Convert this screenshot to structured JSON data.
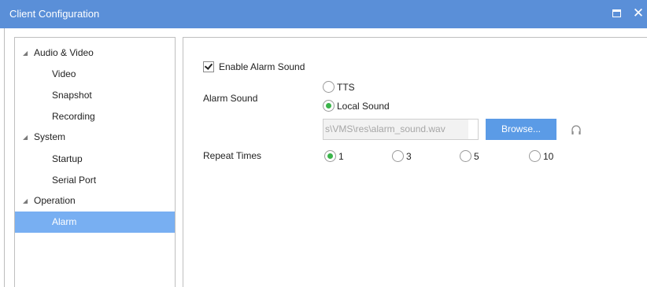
{
  "window": {
    "title": "Client Configuration",
    "maximize_icon": "maximize-icon",
    "close_symbol": "✕",
    "close_icon": "close-icon"
  },
  "colors": {
    "titlebar": "#5a8fd8",
    "selected": "#78aff2",
    "button": "#5b9be6",
    "radio_dot": "#3bb44a"
  },
  "tree": {
    "groups": [
      {
        "label": "Audio & Video",
        "expanded": true
      },
      {
        "label": "System",
        "expanded": true
      },
      {
        "label": "Operation",
        "expanded": true
      }
    ],
    "items": [
      {
        "label": "Video"
      },
      {
        "label": "Snapshot"
      },
      {
        "label": "Recording"
      },
      {
        "label": "Startup"
      },
      {
        "label": "Serial Port"
      },
      {
        "label": "Alarm",
        "selected": true
      }
    ],
    "expand_arrow": "◢"
  },
  "alarm": {
    "enable_label": "Enable Alarm Sound",
    "enable_checked": true,
    "alarm_sound_label": "Alarm Sound",
    "sound_options": [
      {
        "label": "TTS",
        "selected": false
      },
      {
        "label": "Local Sound",
        "selected": true
      }
    ],
    "file_path": "s\\VMS\\res\\alarm_sound.wav",
    "browse_label": "Browse...",
    "preview_icon": "headphone-icon",
    "repeat_label": "Repeat Times",
    "repeat_options": [
      {
        "label": "1",
        "selected": true
      },
      {
        "label": "3",
        "selected": false
      },
      {
        "label": "5",
        "selected": false
      },
      {
        "label": "10",
        "selected": false
      }
    ]
  }
}
